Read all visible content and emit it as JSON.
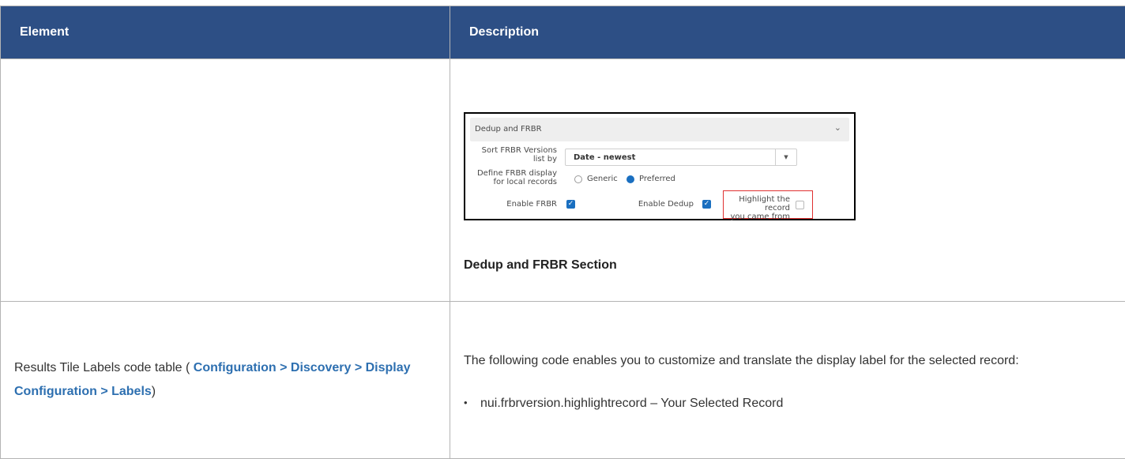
{
  "table": {
    "header": {
      "element": "Element",
      "description": "Description"
    },
    "row1": {
      "element": "",
      "caption": "Dedup and FRBR Section",
      "screenshot": {
        "title": "Dedup and FRBR",
        "sort_label_line1": "Sort FRBR Versions",
        "sort_label_line2": "list by",
        "sort_value": "Date - newest",
        "define_label_line1": "Define FRBR display",
        "define_label_line2": "for local records",
        "radio_generic": "Generic",
        "radio_preferred": "Preferred",
        "enable_frbr": "Enable FRBR",
        "enable_dedup": "Enable Dedup",
        "highlight_line1": "Highlight the record",
        "highlight_line2": "you came from",
        "highlight_color": "#e03030",
        "accent_color": "#1a6fc0"
      }
    },
    "row2": {
      "element_prefix": "Results Tile Labels code table ( ",
      "element_path": "Configuration > Discovery > Display Configuration > Labels",
      "element_suffix": ")",
      "description_text": "The following code enables you to customize and translate the display label for the selected record:",
      "bullet": "nui.frbrversion.highlightrecord – Your Selected Record"
    }
  },
  "colors": {
    "header_bg": "#2d4f85",
    "link": "#2d6fb0",
    "border": "#b4b4b4"
  }
}
